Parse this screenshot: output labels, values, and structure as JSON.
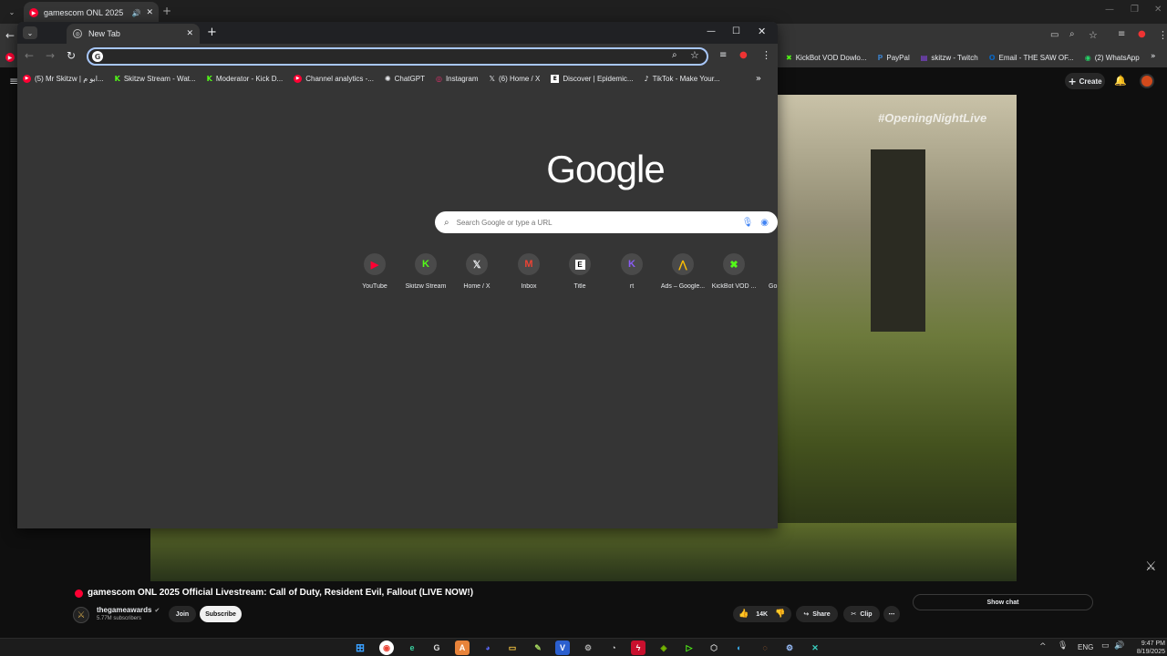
{
  "bg_window": {
    "tab_title": "gamescom ONL 2025 O",
    "bookmarks_right": [
      "KickBot VOD Dowlo...",
      "PayPal",
      "skitzw - Twitch",
      "Email - THE SAW OF...",
      "(2) WhatsApp"
    ],
    "create_label": "Create"
  },
  "front_window": {
    "tab_title": "New Tab",
    "address_value": "",
    "bookmarks": [
      "(5) Mr Skitzw | ابو م...",
      "Skitzw Stream - Wat...",
      "Moderator - Kick D...",
      "Channel analytics -...",
      "ChatGPT",
      "Instagram",
      "(6) Home / X",
      "Discover | Epidemic...",
      "TikTok - Make Your..."
    ],
    "logo": "Google",
    "search_placeholder": "Search Google or type a URL",
    "shortcuts": [
      "YouTube",
      "Skitzw Stream",
      "Home / X",
      "Inbox",
      "Title",
      "rt",
      "Ads – Google...",
      "KickBot VOD ...",
      "Go"
    ]
  },
  "video": {
    "overlay_text": "#OpeningNightLive"
  },
  "youtube": {
    "title": "gamescom ONL 2025 Official Livestream: Call of Duty, Resident Evil, Fallout (LIVE NOW!)",
    "channel": "thegameawards",
    "subscribers": "5.77M subscribers",
    "join": "Join",
    "subscribe": "Subscribe",
    "likes": "14K",
    "share": "Share",
    "clip": "Clip",
    "show_chat": "Show chat"
  },
  "taskbar": {
    "lang": "ENG",
    "time": "9:47 PM",
    "date": "8/19/2025"
  },
  "colors": {
    "accent_red": "#ff0033",
    "new_tab_bg": "#353535",
    "frame_bg": "#202124"
  }
}
